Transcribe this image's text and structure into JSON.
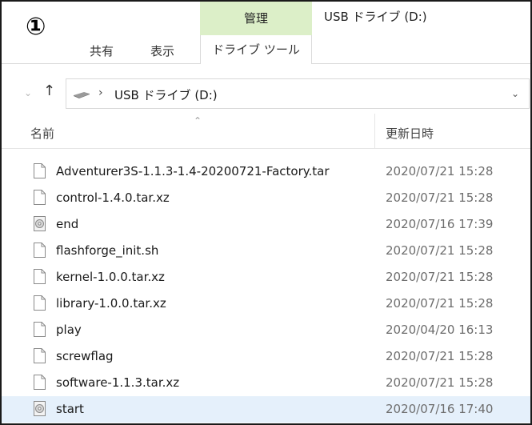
{
  "marker": "①",
  "ribbon": {
    "manage_tab": "管理",
    "window_title": "USB ドライブ (D:)",
    "tabs": {
      "share": "共有",
      "view": "表示",
      "drive_tools": "ドライブ ツール"
    }
  },
  "address": {
    "crumb": "USB ドライブ (D:)"
  },
  "columns": {
    "name": "名前",
    "date_modified": "更新日時"
  },
  "files": [
    {
      "name": "Adventurer3S-1.1.3-1.4-20200721-Factory.tar",
      "date": "2020/07/21 15:28",
      "icon": "document-icon"
    },
    {
      "name": "control-1.4.0.tar.xz",
      "date": "2020/07/21 15:28",
      "icon": "document-icon"
    },
    {
      "name": "end",
      "date": "2020/07/16 17:39",
      "icon": "disc-image-icon"
    },
    {
      "name": "flashforge_init.sh",
      "date": "2020/07/21 15:28",
      "icon": "document-icon"
    },
    {
      "name": "kernel-1.0.0.tar.xz",
      "date": "2020/07/21 15:28",
      "icon": "document-icon"
    },
    {
      "name": "library-1.0.0.tar.xz",
      "date": "2020/07/21 15:28",
      "icon": "document-icon"
    },
    {
      "name": "play",
      "date": "2020/04/20 16:13",
      "icon": "document-icon"
    },
    {
      "name": "screwflag",
      "date": "2020/07/21 15:28",
      "icon": "document-icon"
    },
    {
      "name": "software-1.1.3.tar.xz",
      "date": "2020/07/21 15:28",
      "icon": "document-icon"
    },
    {
      "name": "start",
      "date": "2020/07/16 17:40",
      "icon": "disc-image-icon",
      "selected": true
    }
  ],
  "colors": {
    "manage_tab_bg": "#dcefc8",
    "selection_bg": "#e5f0fb"
  }
}
